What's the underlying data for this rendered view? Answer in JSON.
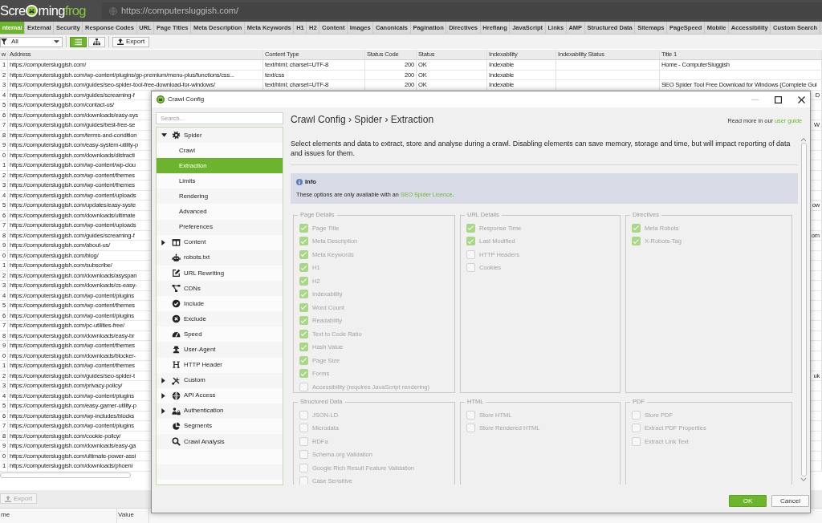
{
  "app": {
    "logo": {
      "before_icon": "Scre",
      "after_icon": "ming",
      "accent": "frog"
    },
    "address_bar": {
      "value": "https://computersluggish.com/"
    },
    "tabs": [
      {
        "label": "nternal",
        "selected": true
      },
      {
        "label": "External",
        "selected": false
      },
      {
        "label": "Security",
        "selected": false
      },
      {
        "label": "Response Codes",
        "selected": false
      },
      {
        "label": "URL",
        "selected": false
      },
      {
        "label": "Page Titles",
        "selected": false
      },
      {
        "label": "Meta Description",
        "selected": false
      },
      {
        "label": "Meta Keywords",
        "selected": false
      },
      {
        "label": "H1",
        "selected": false
      },
      {
        "label": "H2",
        "selected": false
      },
      {
        "label": "Content",
        "selected": false
      },
      {
        "label": "Images",
        "selected": false
      },
      {
        "label": "Canonicals",
        "selected": false
      },
      {
        "label": "Pagination",
        "selected": false
      },
      {
        "label": "Directives",
        "selected": false
      },
      {
        "label": "Hreflang",
        "selected": false
      },
      {
        "label": "JavaScript",
        "selected": false
      },
      {
        "label": "Links",
        "selected": false
      },
      {
        "label": "AMP",
        "selected": false
      },
      {
        "label": "Structured Data",
        "selected": false
      },
      {
        "label": "Sitemaps",
        "selected": false
      },
      {
        "label": "PageSpeed",
        "selected": false
      },
      {
        "label": "Mobile",
        "selected": false
      },
      {
        "label": "Accessibility",
        "selected": false
      },
      {
        "label": "Custom Search",
        "selected": false
      }
    ],
    "toolbar": {
      "filter": {
        "value": "All"
      },
      "views": [
        {
          "kind": "list",
          "selected": true
        },
        {
          "kind": "tree",
          "selected": false
        }
      ],
      "export_button": {
        "label": "Export",
        "disabled": false
      }
    },
    "table": {
      "columns": [
        "w",
        "Address",
        "Content Type",
        "Status Code",
        "Status",
        "Indexability",
        "Indexability Status",
        "Title 1"
      ],
      "rows": [
        {
          "row": "1",
          "address": "https://computersluggish.com/",
          "content_type": "text/html; charset=UTF-8",
          "status_code": "200",
          "status": "OK",
          "indexability": "Indexable",
          "title_1": "Home - ComputerSluggish"
        },
        {
          "row": "2",
          "address": "https://computersluggish.com/wp-content/plugins/gp-premium/menu-plus/functions/css...",
          "content_type": "text/css",
          "status_code": "200",
          "status": "OK",
          "indexability": "Indexable"
        },
        {
          "row": "3",
          "address": "https://computersluggish.com/guides/seo-spider-tool-free-download-for-windows/",
          "content_type": "text/html; charset=UTF-8",
          "status_code": "200",
          "status": "OK",
          "indexability": "Indexable",
          "title_1": "SEO Spider Tool Free Download for Windows (Complete Gui"
        },
        {
          "row": "4",
          "address": "https://computersluggish.com/guides/screaming-f",
          "title_1_tail": "D"
        },
        {
          "row": "5",
          "address": "https://computersluggish.com/contact-us/"
        },
        {
          "row": "6",
          "address": "https://computersluggish.com/downloads/easy-sys"
        },
        {
          "row": "7",
          "address": "https://computersluggish.com/guides/best-free-se",
          "title_1_tail": "W"
        },
        {
          "row": "8",
          "address": "https://computersluggish.com/terms-and-condition"
        },
        {
          "row": "9",
          "address": "https://computersluggish.com/easy-system-utility-p"
        },
        {
          "row": "0",
          "address": "https://computersluggish.com/downloads/distracti"
        },
        {
          "row": "1",
          "address": "https://computersluggish.com/wp-content/wp-clou"
        },
        {
          "row": "2",
          "address": "https://computersluggish.com/wp-content/themes"
        },
        {
          "row": "3",
          "address": "https://computersluggish.com/wp-content/themes"
        },
        {
          "row": "4",
          "address": "https://computersluggish.com/wp-content/uploads"
        },
        {
          "row": "5",
          "address": "https://computersluggish.com/updates/easy-syste",
          "title_1_tail": "ow"
        },
        {
          "row": "6",
          "address": "https://computersluggish.com/downloads/ultimate"
        },
        {
          "row": "7",
          "address": "https://computersluggish.com/wp-content/uploads"
        },
        {
          "row": "8",
          "address": "https://computersluggish.com/guides/screaming-f",
          "title_1_tail": "om"
        },
        {
          "row": "9",
          "address": "https://computersluggish.com/about-us/"
        },
        {
          "row": "0",
          "address": "https://computersluggish.com/blog/"
        },
        {
          "row": "1",
          "address": "https://computersluggish.com/subscribe/"
        },
        {
          "row": "2",
          "address": "https://computersluggish.com/downloads/asyspan"
        },
        {
          "row": "3",
          "address": "https://computersluggish.com/downloads/cs-easy-"
        },
        {
          "row": "4",
          "address": "https://computersluggish.com/wp-content/plugins"
        },
        {
          "row": "5",
          "address": "https://computersluggish.com/wp-content/themes"
        },
        {
          "row": "6",
          "address": "https://computersluggish.com/wp-content/plugins"
        },
        {
          "row": "7",
          "address": "https://computersluggish.com/pc-utilities-free/"
        },
        {
          "row": "8",
          "address": "https://computersluggish.com/downloads/easy-br"
        },
        {
          "row": "9",
          "address": "https://computersluggish.com/wp-content/themes"
        },
        {
          "row": "0",
          "address": "https://computersluggish.com/downloads/blocker-"
        },
        {
          "row": "1",
          "address": "https://computersluggish.com/wp-content/themes"
        },
        {
          "row": "2",
          "address": "https://computersluggish.com/guides/seo-spider-t",
          "title_1_tail": "uk"
        },
        {
          "row": "3",
          "address": "https://computersluggish.com/privacy-policy/"
        },
        {
          "row": "4",
          "address": "https://computersluggish.com/wp-content/plugins"
        },
        {
          "row": "5",
          "address": "https://computersluggish.com/easy-gamer-utility-p"
        },
        {
          "row": "6",
          "address": "https://computersluggish.com/wp-includes/blocks"
        },
        {
          "row": "7",
          "address": "https://computersluggish.com/wp-content/plugins"
        },
        {
          "row": "8",
          "address": "https://computersluggish.com/cookie-policy/"
        },
        {
          "row": "9",
          "address": "https://computersluggish.com/downloads/easy-ga"
        },
        {
          "row": "0",
          "address": "https://computersluggish.com/ultimate-power-assi"
        },
        {
          "row": "1",
          "address": "https://computersluggish.com/downloads/phoeni"
        }
      ]
    },
    "details_pane": {
      "export_button": {
        "label": "Export",
        "disabled": true
      },
      "columns": [
        "me",
        "Value"
      ]
    }
  },
  "dialog": {
    "title": "Crawl Config",
    "window_buttons": [
      {
        "kind": "minimize",
        "disabled": true
      },
      {
        "kind": "maximize",
        "disabled": false
      },
      {
        "kind": "close",
        "disabled": false
      }
    ],
    "search": {
      "placeholder": "Search..."
    },
    "nav": [
      {
        "label": "Spider",
        "kind": "group",
        "expanded": true,
        "selected": false,
        "children": [
          {
            "label": "Crawl",
            "selected": false
          },
          {
            "label": "Extraction",
            "selected": true
          },
          {
            "label": "Limits",
            "selected": false
          },
          {
            "label": "Rendering",
            "selected": false
          },
          {
            "label": "Advanced",
            "selected": false
          },
          {
            "label": "Preferences",
            "selected": false
          }
        ]
      },
      {
        "label": "Content",
        "kind": "group",
        "expanded": false,
        "selected": false
      },
      {
        "label": "robots.txt",
        "kind": "page",
        "selected": false
      },
      {
        "label": "URL Rewriting",
        "kind": "page",
        "selected": false
      },
      {
        "label": "CDNs",
        "kind": "page",
        "selected": false
      },
      {
        "label": "Include",
        "kind": "page",
        "selected": false
      },
      {
        "label": "Exclude",
        "kind": "page",
        "selected": false
      },
      {
        "label": "Speed",
        "kind": "page",
        "selected": false
      },
      {
        "label": "User-Agent",
        "kind": "page",
        "selected": false
      },
      {
        "label": "HTTP Header",
        "kind": "page",
        "selected": false
      },
      {
        "label": "Custom",
        "kind": "group",
        "expanded": false,
        "selected": false
      },
      {
        "label": "API Access",
        "kind": "group",
        "expanded": false,
        "selected": false
      },
      {
        "label": "Authentication",
        "kind": "group",
        "expanded": false,
        "selected": false
      },
      {
        "label": "Segments",
        "kind": "page",
        "selected": false
      },
      {
        "label": "Crawl Analysis",
        "kind": "page",
        "selected": false
      }
    ],
    "breadcrumb": "Crawl Config › Spider › Extraction",
    "help": {
      "text": "Read more in our ",
      "link": "user guide"
    },
    "description": "Select elements and data to extract, store and analyse during a crawl. Disabling elements can save memory, storage and time, but will impact reporting of data and issues for them.",
    "info": {
      "title": "Info",
      "text_before": "These options are only available with an ",
      "link": "SEO Spider Licence",
      "text_after": "."
    },
    "options_disabled": true,
    "groups": [
      {
        "title": "Page Details",
        "options": [
          {
            "label": "Page Title",
            "checked": true
          },
          {
            "label": "Meta Description",
            "checked": true
          },
          {
            "label": "Meta Keywords",
            "checked": true
          },
          {
            "label": "H1",
            "checked": true
          },
          {
            "label": "H2",
            "checked": true
          },
          {
            "label": "Indexability",
            "checked": true
          },
          {
            "label": "Word Count",
            "checked": true
          },
          {
            "label": "Readability",
            "checked": true
          },
          {
            "label": "Text to Code Ratio",
            "checked": true
          },
          {
            "label": "Hash Value",
            "checked": true
          },
          {
            "label": "Page Size",
            "checked": true
          },
          {
            "label": "Forms",
            "checked": true
          },
          {
            "label": "Accessibility (requires JavaScript rendering)",
            "checked": false
          }
        ]
      },
      {
        "title": "URL Details",
        "options": [
          {
            "label": "Response Time",
            "checked": true
          },
          {
            "label": "Last Modified",
            "checked": true
          },
          {
            "label": "HTTP Headers",
            "checked": false
          },
          {
            "label": "Cookies",
            "checked": false
          }
        ]
      },
      {
        "title": "Directives",
        "options": [
          {
            "label": "Meta Robots",
            "checked": true
          },
          {
            "label": "X-Robots-Tag",
            "checked": true
          }
        ]
      },
      {
        "title": "Structured Data",
        "options": [
          {
            "label": "JSON-LD",
            "checked": false
          },
          {
            "label": "Microdata",
            "checked": false
          },
          {
            "label": "RDFa",
            "checked": false
          },
          {
            "label": "Schema.org Validation",
            "checked": false
          },
          {
            "label": "Google Rich Result Feature Validation",
            "checked": false
          },
          {
            "label": "Case Sensitive",
            "checked": false
          }
        ]
      },
      {
        "title": "HTML",
        "options": [
          {
            "label": "Store HTML",
            "checked": false
          },
          {
            "label": "Store Rendered HTML",
            "checked": false
          }
        ]
      },
      {
        "title": "PDF",
        "options": [
          {
            "label": "Store PDF",
            "checked": false
          },
          {
            "label": "Extract PDF Properties",
            "checked": false
          },
          {
            "label": "Extract Link Text",
            "checked": false
          }
        ]
      }
    ],
    "buttons": [
      {
        "label": "OK",
        "kind": "primary"
      },
      {
        "label": "Cancel",
        "kind": "secondary"
      }
    ]
  }
}
